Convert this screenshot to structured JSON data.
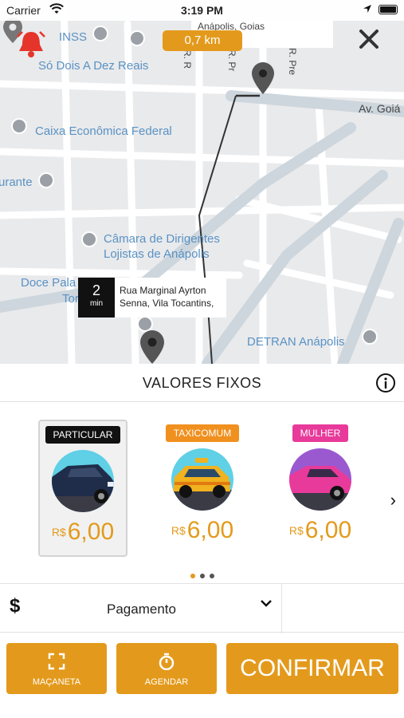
{
  "status_bar": {
    "carrier": "Carrier",
    "time": "3:19 PM"
  },
  "map": {
    "labels": {
      "address_top": "Anápolis, Goias",
      "inss": "INSS",
      "so_dois": "Só Dois A Dez Reais",
      "caixa": "Caixa Econômica Federal",
      "rante": "urante",
      "camara": "Câmara de Dirigentes\nLojistas de Anápolis",
      "doce_pala": "Doce Pala",
      "tor": "Tor",
      "detran": "DETRAN Anápolis",
      "av_goia": "Av. Goiá",
      "street_r1": "R. R",
      "street_r2": "R. Pr",
      "street_r3": "R. Pre"
    },
    "distance": "0,7 km",
    "eta_value": "2",
    "eta_unit": "min",
    "eta_address": "Rua Marginal Ayrton Senna, Vila Tocantins,"
  },
  "panel": {
    "title": "VALORES FIXOS",
    "cars": [
      {
        "tag": "PARTICULAR",
        "currency": "R$",
        "price": "6,00",
        "tag_color": "#111111",
        "selected": true
      },
      {
        "tag": "TAXICOMUM",
        "currency": "R$",
        "price": "6,00",
        "tag_color": "#f0901e",
        "selected": false
      },
      {
        "tag": "MULHER",
        "currency": "R$",
        "price": "6,00",
        "tag_color": "#e83a9a",
        "selected": false
      }
    ],
    "payment": {
      "symbol": "$",
      "label": "Pagamento"
    },
    "buttons": {
      "macaneta": "MAÇANETA",
      "agendar": "AGENDAR",
      "confirmar": "CONFIRMAR"
    },
    "accent_color": "#e39a1c"
  }
}
